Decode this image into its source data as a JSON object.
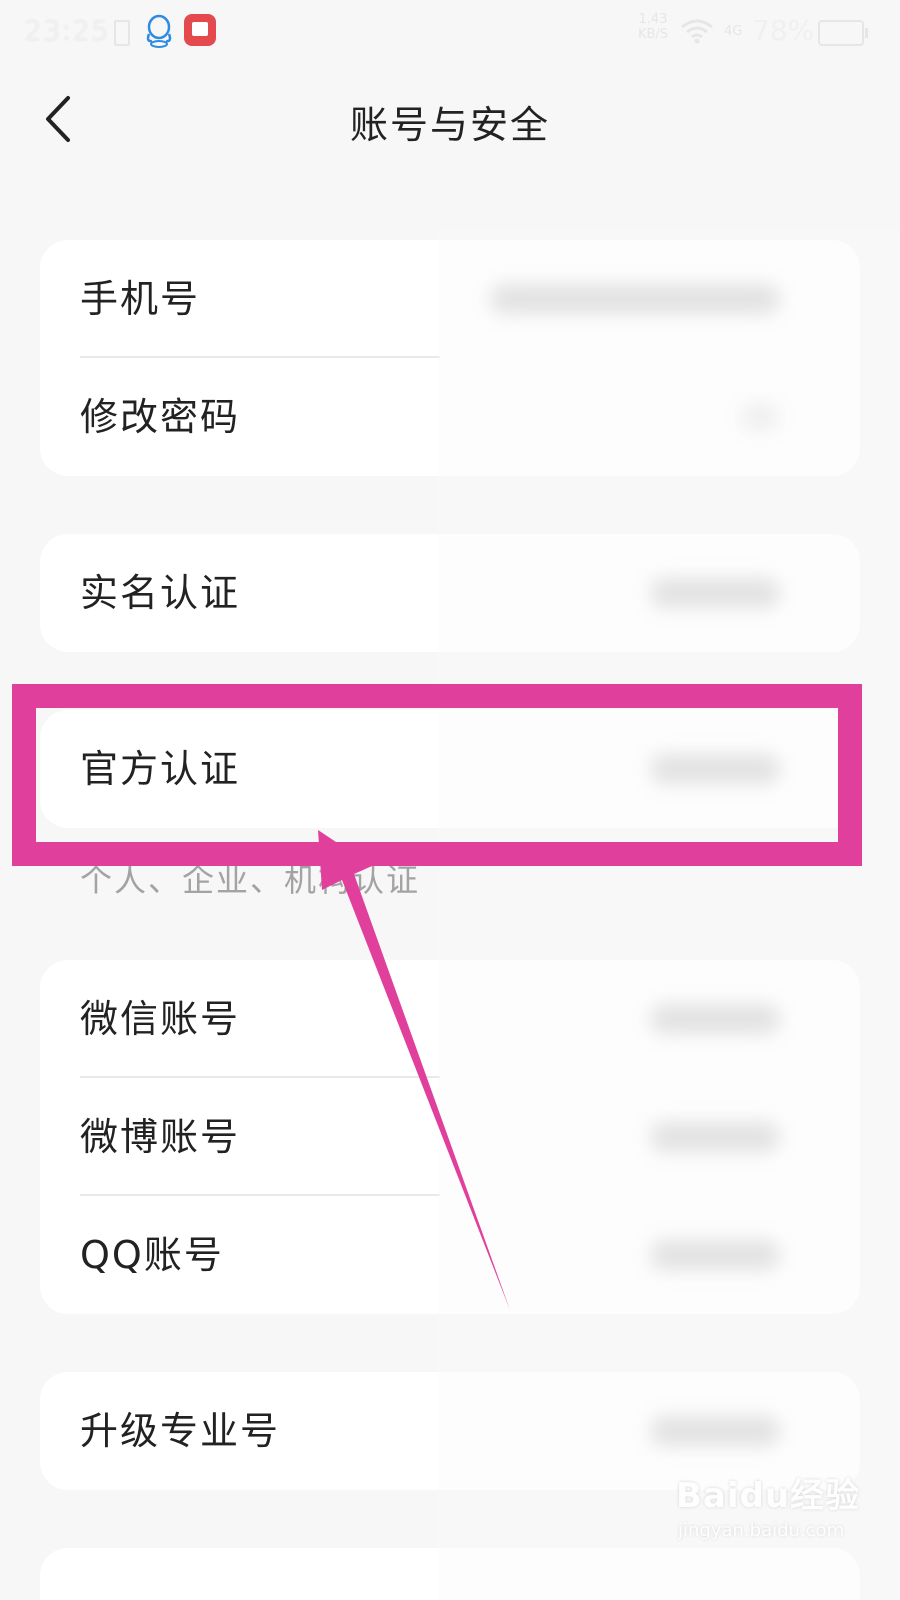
{
  "status_bar": {
    "time": "23:25",
    "speed_value": "1.43",
    "speed_unit": "KB/S",
    "signal": "4G",
    "battery": "78%",
    "icons": [
      "vibrate-icon",
      "qq-icon",
      "app-icon",
      "wifi-icon",
      "signal-icon",
      "battery-icon"
    ]
  },
  "header": {
    "title": "账号与安全"
  },
  "sections": {
    "account": {
      "phone_label": "手机号",
      "password_label": "修改密码"
    },
    "verify": {
      "realname_label": "实名认证",
      "official_label": "官方认证",
      "official_note": "个人、企业、机构认证"
    },
    "bindings": {
      "wechat_label": "微信账号",
      "weibo_label": "微博账号",
      "qq_label": "QQ账号"
    },
    "pro": {
      "upgrade_label": "升级专业号"
    }
  },
  "watermark": {
    "logo": "Baidu经验",
    "url": "jingyan.baidu.com"
  },
  "colors": {
    "background": "#f7f7f8",
    "card": "#ffffff",
    "annotation": "#e0409c",
    "text": "#222222",
    "note": "#a3a3a3"
  }
}
